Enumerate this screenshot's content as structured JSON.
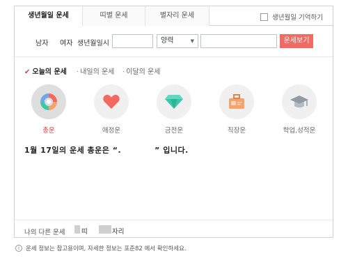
{
  "tabs": [
    {
      "label": "생년월일 운세",
      "active": true
    },
    {
      "label": "띠별 운세",
      "active": false
    },
    {
      "label": "별자리 운세",
      "active": false
    }
  ],
  "remember_label": "생년월일 기억하기",
  "form": {
    "gender_male": "남자",
    "gender_female": "여자",
    "birth_label": "생년월일시",
    "birth_value": "",
    "calendar_selected": "양력",
    "time_value": "",
    "submit_label": "운세보기"
  },
  "subtabs": [
    {
      "label": "오늘의 운세",
      "active": true
    },
    {
      "label": "내일의 운세",
      "active": false
    },
    {
      "label": "이달의 운세",
      "active": false
    }
  ],
  "categories": [
    {
      "label": "총운",
      "icon": "pie-chart-icon",
      "active": true
    },
    {
      "label": "애정운",
      "icon": "heart-icon",
      "active": false
    },
    {
      "label": "금전운",
      "icon": "diamond-icon",
      "active": false
    },
    {
      "label": "직장운",
      "icon": "briefcase-icon",
      "active": false
    },
    {
      "label": "학업,성적운",
      "icon": "graduation-cap-icon",
      "active": false
    }
  ],
  "result": {
    "prefix": "1월 17일의 운세 총운은 “.",
    "suffix": "” 입니다."
  },
  "bottom": {
    "label": "나의 다른 운세",
    "zodiac_suffix": "띠",
    "star_suffix": "자리"
  },
  "footnote": "운세 정보는 참고용이며, 자세한 정보는 포춘82 에서 확인하세요.",
  "colors": {
    "accent": "#f06b63",
    "active_text": "#e0403a",
    "border": "#cfd3d8",
    "heart": "#f26a5f",
    "diamond": "#3cc7a8",
    "briefcase": "#f5a26b",
    "cap": "#8f9aa6"
  }
}
